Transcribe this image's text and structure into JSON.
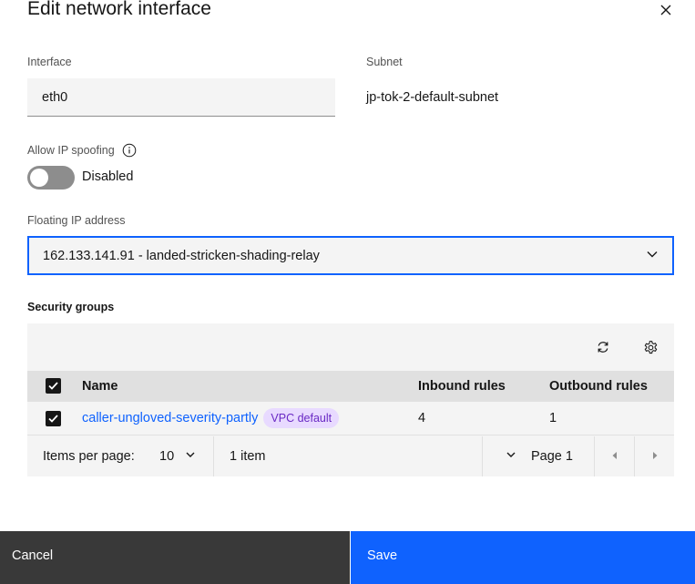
{
  "modal": {
    "title": "Edit network interface"
  },
  "interface": {
    "label": "Interface",
    "value": "eth0"
  },
  "subnet": {
    "label": "Subnet",
    "value": "jp-tok-2-default-subnet"
  },
  "spoofing": {
    "label": "Allow IP spoofing",
    "state_text": "Disabled",
    "enabled": false
  },
  "floating_ip": {
    "label": "Floating IP address",
    "selected": "162.133.141.91 - landed-stricken-shading-relay"
  },
  "security_groups": {
    "title": "Security groups",
    "columns": {
      "name": "Name",
      "inbound": "Inbound rules",
      "outbound": "Outbound rules"
    },
    "rows": [
      {
        "name": "caller-ungloved-severity-partly",
        "tag": "VPC default",
        "inbound": "4",
        "outbound": "1",
        "selected": true
      }
    ],
    "pagination": {
      "items_per_page_label": "Items per page:",
      "items_per_page": "10",
      "item_count": "1 item",
      "page": "Page 1"
    }
  },
  "footer": {
    "cancel_label": "Cancel",
    "save_label": "Save"
  },
  "colors": {
    "primary": "#0f62fe",
    "tag_bg": "#e8daff",
    "tag_text": "#6929c4",
    "cancel_bg": "#393939"
  }
}
